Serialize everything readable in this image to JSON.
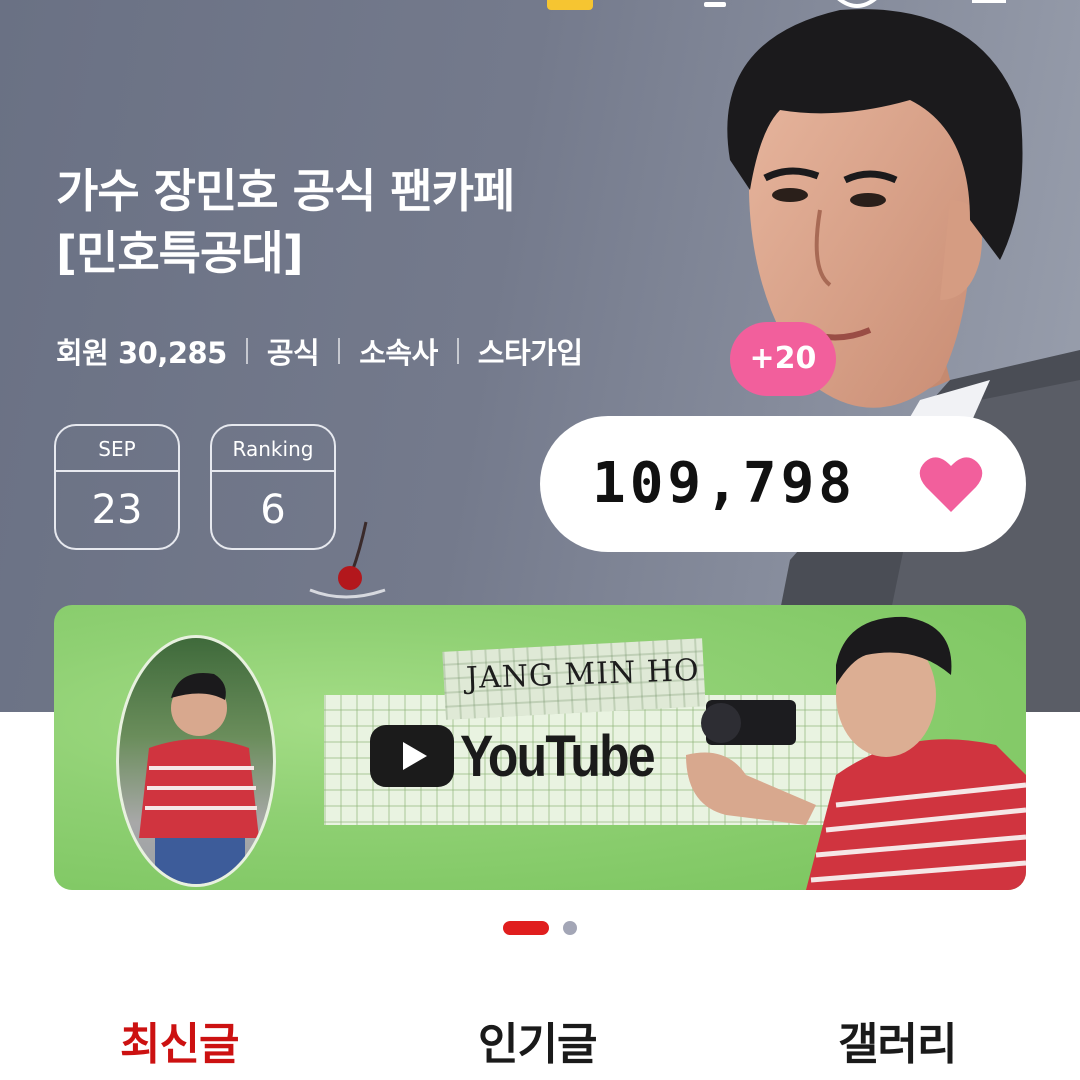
{
  "cafe": {
    "title_line1": "가수 장민호 공식 팬카페",
    "title_line2": "[민호특공대]",
    "meta": [
      "회원 30,285",
      "공식",
      "소속사",
      "스타가입"
    ]
  },
  "stats": [
    {
      "label": "SEP",
      "value": "23"
    },
    {
      "label": "Ranking",
      "value": "6"
    }
  ],
  "likes": {
    "increment": "+20",
    "count": "109,798",
    "icon": "heart-icon"
  },
  "banner": {
    "name_text": "JANG MIN HO",
    "youtube_text": "YouTube"
  },
  "carousel": {
    "pages": 2,
    "active_page": 1
  },
  "tabs": [
    {
      "label": "최신글",
      "active": true
    },
    {
      "label": "인기글",
      "active": false
    },
    {
      "label": "갤러리",
      "active": false
    }
  ],
  "colors": {
    "accent_red": "#cc1111",
    "pink": "#f25f9c",
    "hero_bg": "#747a8c"
  }
}
